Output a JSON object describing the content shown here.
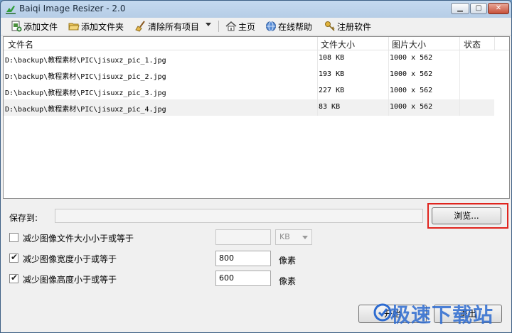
{
  "window": {
    "title": "Baiqi Image Resizer - 2.0"
  },
  "toolbar": {
    "add_file": "添加文件",
    "add_folder": "添加文件夹",
    "clear_all": "清除所有项目",
    "home": "主页",
    "online_help": "在线帮助",
    "register": "注册软件"
  },
  "file_list": {
    "columns": [
      "文件名",
      "文件大小",
      "图片大小",
      "状态"
    ],
    "rows": [
      {
        "name": "D:\\backup\\教程素材\\PIC\\jisuxz_pic_1.jpg",
        "size": "108 KB",
        "dimensions": "1000 x 562",
        "status": ""
      },
      {
        "name": "D:\\backup\\教程素材\\PIC\\jisuxz_pic_2.jpg",
        "size": "193 KB",
        "dimensions": "1000 x 562",
        "status": ""
      },
      {
        "name": "D:\\backup\\教程素材\\PIC\\jisuxz_pic_3.jpg",
        "size": "227 KB",
        "dimensions": "1000 x 562",
        "status": ""
      },
      {
        "name": "D:\\backup\\教程素材\\PIC\\jisuxz_pic_4.jpg",
        "size": "83 KB",
        "dimensions": "1000 x 562",
        "status": ""
      }
    ]
  },
  "save": {
    "label": "保存到:",
    "value": "",
    "browse_label": "浏览..."
  },
  "options": {
    "reduce_filesize": {
      "label": "减少图像文件大小小于或等于",
      "checked": false,
      "value": "",
      "unit": "KB"
    },
    "reduce_width": {
      "label": "减少图像宽度小于或等于",
      "checked": true,
      "value": "800",
      "unit": "像素"
    },
    "reduce_height": {
      "label": "减少图像高度小于或等于",
      "checked": true,
      "value": "600",
      "unit": "像素"
    }
  },
  "buttons": {
    "start": "开始",
    "exit": "退出"
  },
  "watermark": {
    "text": "极速下载站"
  },
  "colors": {
    "highlight": "#e0241e",
    "watermark": "#2d6bd0"
  }
}
